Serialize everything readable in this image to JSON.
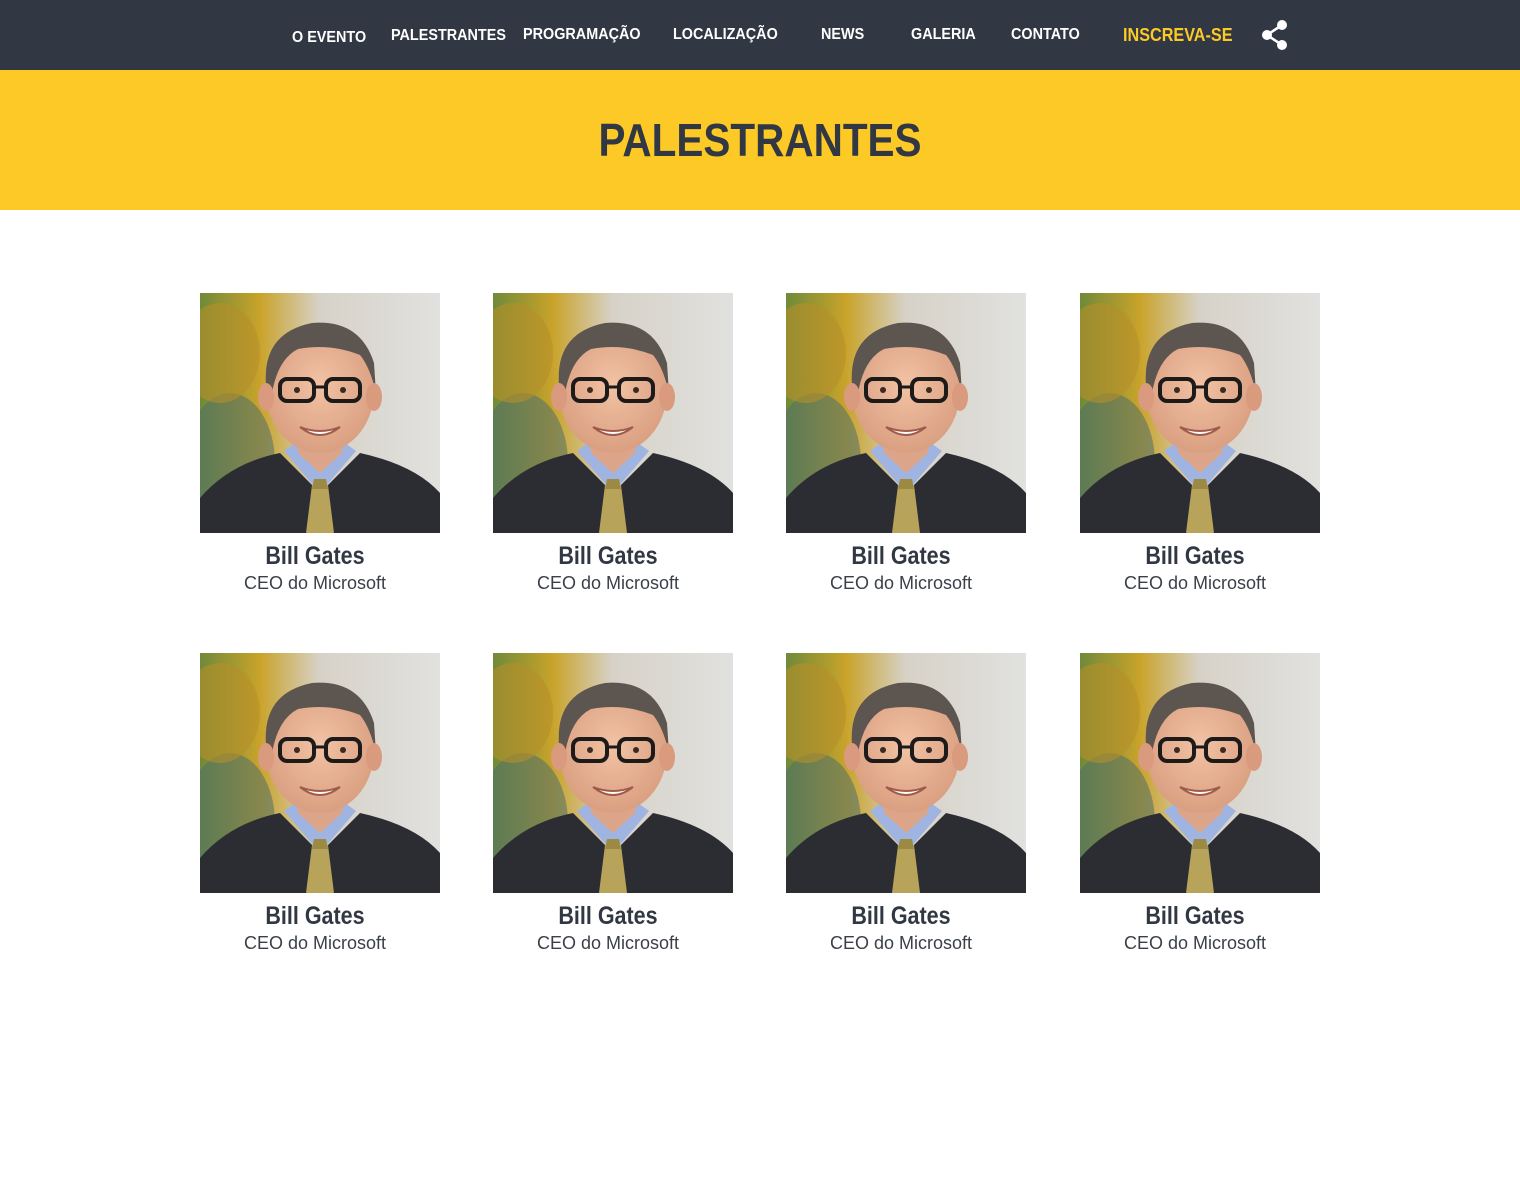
{
  "nav": {
    "items": [
      {
        "label": "O EVENTO"
      },
      {
        "label": "PALESTRANTES"
      },
      {
        "label": "PROGRAMAÇÃO"
      },
      {
        "label": "LOCALIZAÇÃO"
      },
      {
        "label": "NEWS"
      },
      {
        "label": "GALERIA"
      },
      {
        "label": "CONTATO"
      }
    ],
    "cta_label": "INSCREVA-SE",
    "share_icon": "share-icon"
  },
  "hero": {
    "title": "PALESTRANTES"
  },
  "speakers": [
    {
      "name": "Bill Gates",
      "role": "CEO do Microsoft"
    },
    {
      "name": "Bill Gates",
      "role": "CEO do Microsoft"
    },
    {
      "name": "Bill Gates",
      "role": "CEO do Microsoft"
    },
    {
      "name": "Bill Gates",
      "role": "CEO do Microsoft"
    },
    {
      "name": "Bill Gates",
      "role": "CEO do Microsoft"
    },
    {
      "name": "Bill Gates",
      "role": "CEO do Microsoft"
    },
    {
      "name": "Bill Gates",
      "role": "CEO do Microsoft"
    },
    {
      "name": "Bill Gates",
      "role": "CEO do Microsoft"
    }
  ],
  "colors": {
    "nav_bg": "#313843",
    "accent": "#fcc927",
    "text_dark": "#313843"
  }
}
